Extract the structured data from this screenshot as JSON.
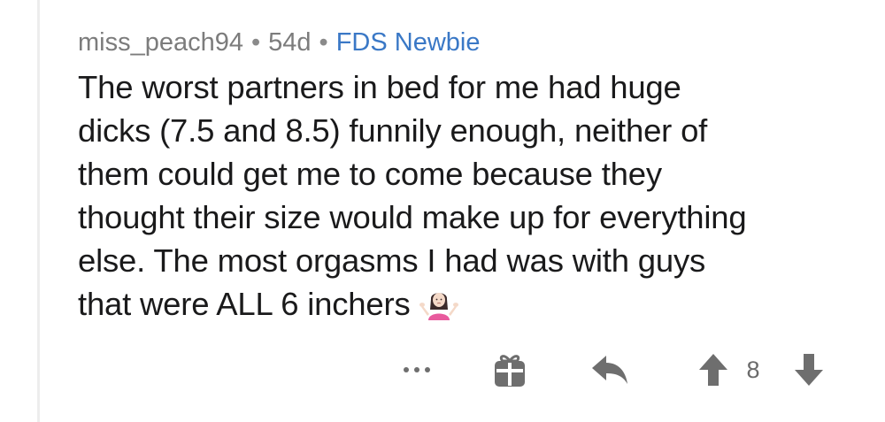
{
  "comment": {
    "username": "miss_peach94",
    "separator": "•",
    "age": "54d",
    "flair": "FDS Newbie",
    "body_lines": [
      "The worst partners in bed for me had huge",
      "dicks (7.5 and 8.5) funnily enough, neither of",
      "them could get me to come because they",
      "thought their size would make up for everything",
      "else. The most orgasms I had was with guys",
      "that were ALL 6 inchers"
    ],
    "emoji": "woman-shrugging-icon"
  },
  "actions": {
    "more_icon": "more-options-icon",
    "award_icon": "gift-award-icon",
    "reply_icon": "reply-arrow-icon",
    "upvote_icon": "upvote-arrow-icon",
    "score": "8",
    "downvote_icon": "downvote-arrow-icon"
  },
  "colors": {
    "username": "#7c7c7c",
    "flair": "#3a78c6",
    "text": "#1a1a1b",
    "icons": "#6e6e6e"
  }
}
